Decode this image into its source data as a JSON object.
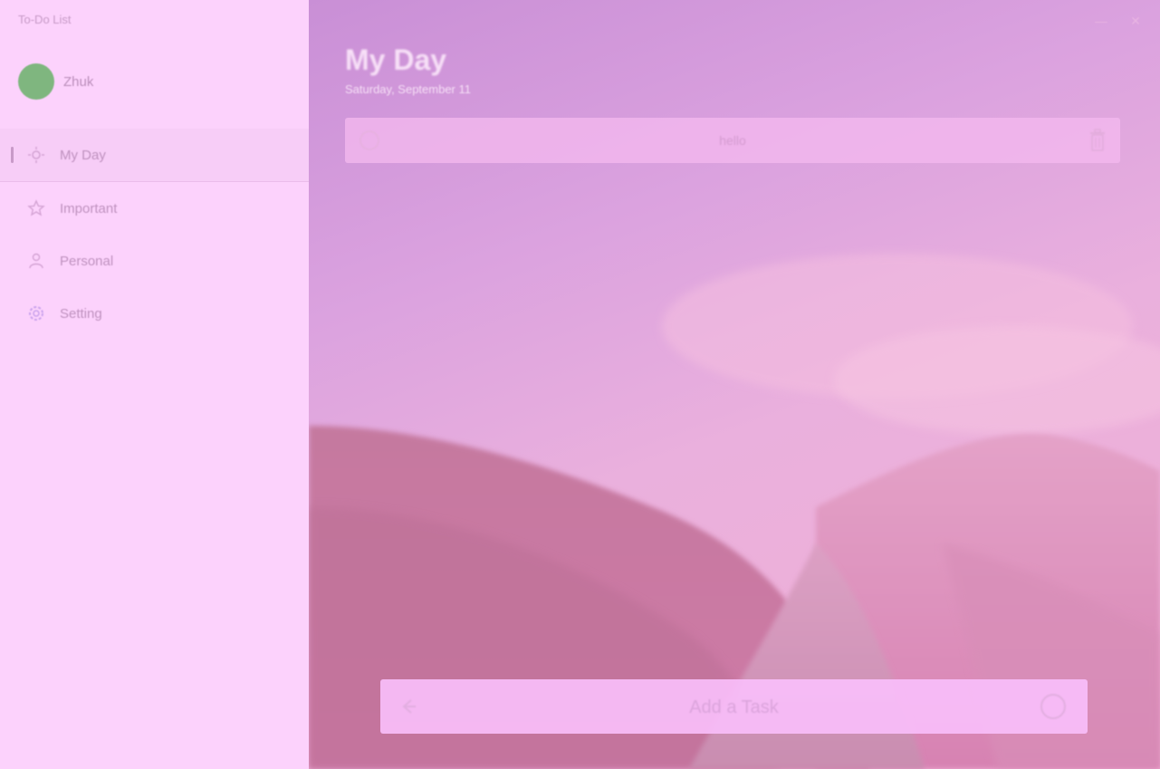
{
  "app": {
    "title": "To-Do List"
  },
  "profile": {
    "name": "Zhuk"
  },
  "sidebar": {
    "items": [
      {
        "label": "My Day",
        "icon": "sun-icon",
        "active": true
      },
      {
        "label": "Important",
        "icon": "star-icon",
        "active": false
      },
      {
        "label": "Personal",
        "icon": "person-icon",
        "active": false
      },
      {
        "label": "Setting",
        "icon": "gear-icon",
        "active": false
      }
    ]
  },
  "window": {
    "minimize": "—",
    "close": "✕"
  },
  "main": {
    "title": "My Day",
    "date": "Saturday, September 11",
    "tasks": [
      {
        "text": "hello"
      }
    ]
  },
  "add_task": {
    "placeholder": "Add a Task"
  },
  "colors": {
    "sidebar_bg": "#fcd2fc",
    "accent": "#c98fd6",
    "avatar": "#7fb67f"
  }
}
